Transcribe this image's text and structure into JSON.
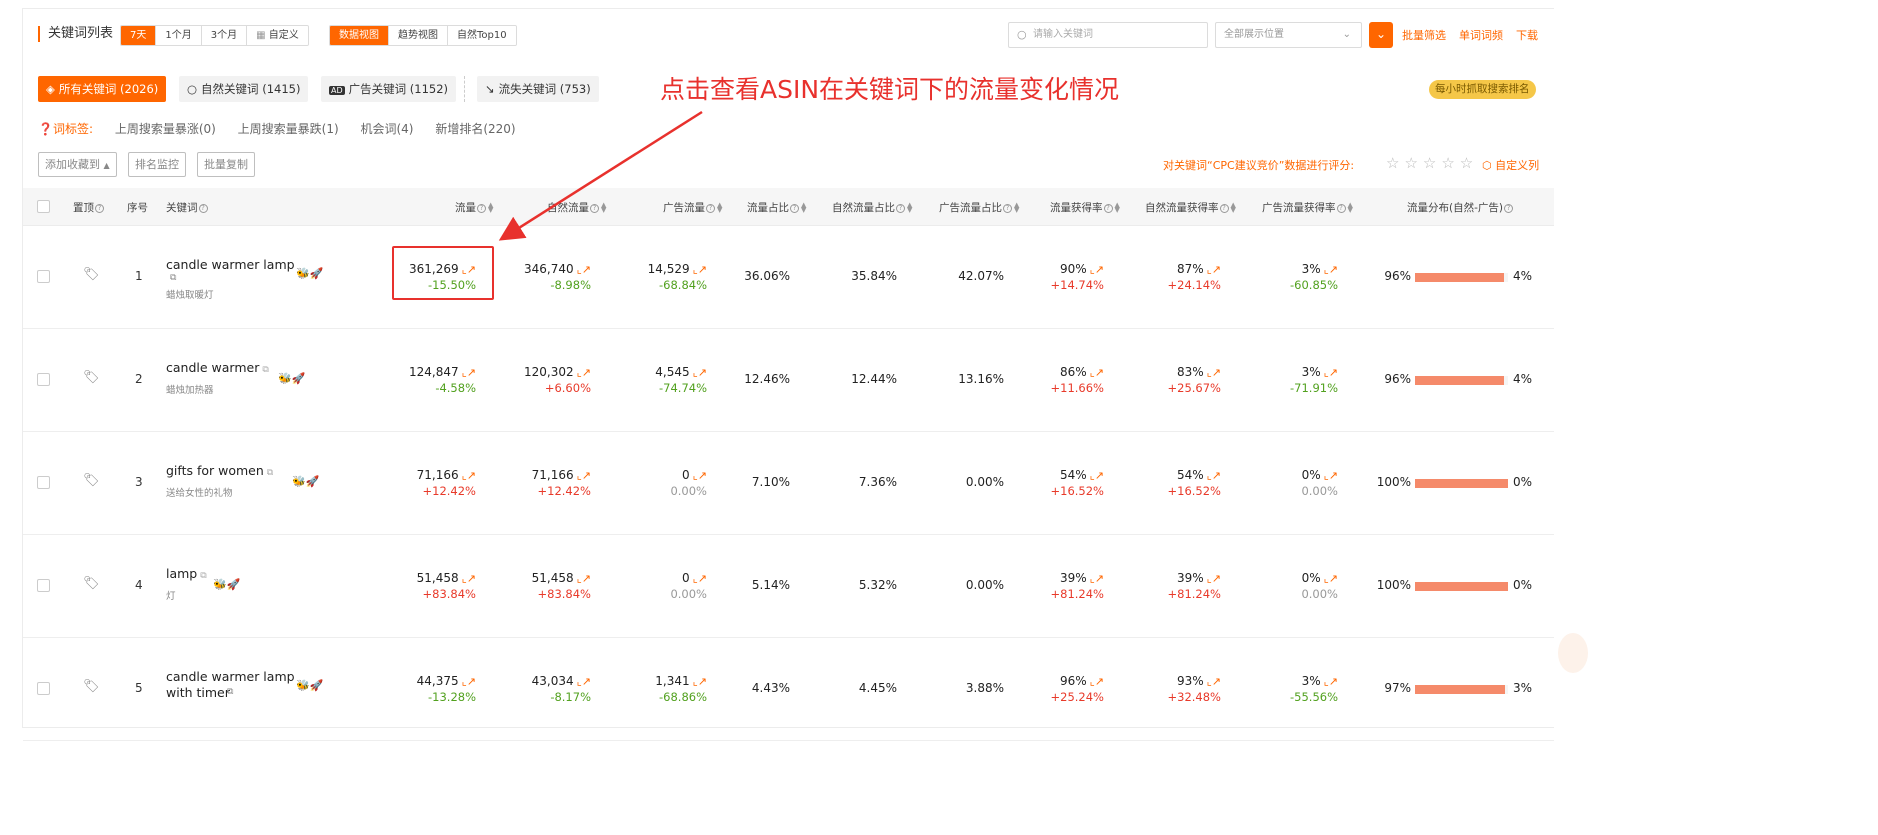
{
  "header": {
    "title": "关键词列表",
    "periods": [
      "7天",
      "1个月",
      "3个月",
      "自定义"
    ],
    "views": [
      "数据视图",
      "趋势视图",
      "自然Top10"
    ],
    "search_placeholder": "请输入关键词",
    "position_select": "全部展示位置",
    "links": [
      "批量筛选",
      "单词词频",
      "下载"
    ]
  },
  "filters": {
    "chips": [
      {
        "label": "所有关键词 (2026)",
        "icon": "layers-icon"
      },
      {
        "label": "自然关键词 (1415)",
        "icon": "search-icon"
      },
      {
        "label": "广告关键词 (1152)",
        "icon": "ad-icon"
      },
      {
        "label": "流失关键词 (753)",
        "icon": "trend-down-icon"
      }
    ],
    "badge": "每小时抓取搜索排名",
    "tag_label": "词标签:",
    "tags": [
      "上周搜索量暴涨(0)",
      "上周搜索量暴跌(1)",
      "机会词(4)",
      "新增排名(220)"
    ]
  },
  "annotation": "点击查看ASIN在关键词下的流量变化情况",
  "toolbar": {
    "buttons": [
      "添加收藏到",
      "排名监控",
      "批量复制"
    ],
    "rate_text": "对关键词“CPC建议竞价”数据进行评分:",
    "stars": "☆☆☆☆☆",
    "custom_cols": "自定义列"
  },
  "columns": [
    "置顶",
    "序号",
    "关键词",
    "流量",
    "自然流量",
    "广告流量",
    "流量占比",
    "自然流量占比",
    "广告流量占比",
    "流量获得率",
    "自然流量获得率",
    "广告流量获得率",
    "流量分布(自然-广告)"
  ],
  "rows": [
    {
      "idx": "1",
      "kw": "candle warmer lamp",
      "zh": "蜡烛取暖灯",
      "traffic": "361,269",
      "traffic_chg": "-15.50%",
      "org": "346,740",
      "org_chg": "-8.98%",
      "ad": "14,529",
      "ad_chg": "-68.84%",
      "share": "36.06%",
      "org_share": "35.84%",
      "ad_share": "42.07%",
      "rate": "90%",
      "rate_chg": "+14.74%",
      "org_rate": "87%",
      "org_rate_chg": "+24.14%",
      "ad_rate": "3%",
      "ad_rate_chg": "-60.85%",
      "dist_l": "96%",
      "dist_r": "4%",
      "dist": 0.96
    },
    {
      "idx": "2",
      "kw": "candle warmer",
      "zh": "蜡烛加热器",
      "traffic": "124,847",
      "traffic_chg": "-4.58%",
      "org": "120,302",
      "org_chg": "+6.60%",
      "ad": "4,545",
      "ad_chg": "-74.74%",
      "share": "12.46%",
      "org_share": "12.44%",
      "ad_share": "13.16%",
      "rate": "86%",
      "rate_chg": "+11.66%",
      "org_rate": "83%",
      "org_rate_chg": "+25.67%",
      "ad_rate": "3%",
      "ad_rate_chg": "-71.91%",
      "dist_l": "96%",
      "dist_r": "4%",
      "dist": 0.96
    },
    {
      "idx": "3",
      "kw": "gifts for women",
      "zh": "送给女性的礼物",
      "traffic": "71,166",
      "traffic_chg": "+12.42%",
      "org": "71,166",
      "org_chg": "+12.42%",
      "ad": "0",
      "ad_chg": "0.00%",
      "share": "7.10%",
      "org_share": "7.36%",
      "ad_share": "0.00%",
      "rate": "54%",
      "rate_chg": "+16.52%",
      "org_rate": "54%",
      "org_rate_chg": "+16.52%",
      "ad_rate": "0%",
      "ad_rate_chg": "0.00%",
      "dist_l": "100%",
      "dist_r": "0%",
      "dist": 1.0
    },
    {
      "idx": "4",
      "kw": "lamp",
      "zh": "灯",
      "traffic": "51,458",
      "traffic_chg": "+83.84%",
      "org": "51,458",
      "org_chg": "+83.84%",
      "ad": "0",
      "ad_chg": "0.00%",
      "share": "5.14%",
      "org_share": "5.32%",
      "ad_share": "0.00%",
      "rate": "39%",
      "rate_chg": "+81.24%",
      "org_rate": "39%",
      "org_rate_chg": "+81.24%",
      "ad_rate": "0%",
      "ad_rate_chg": "0.00%",
      "dist_l": "100%",
      "dist_r": "0%",
      "dist": 1.0
    },
    {
      "idx": "5",
      "kw": "candle warmer lamp",
      "kw2": "with timer",
      "zh": "",
      "traffic": "44,375",
      "traffic_chg": "-13.28%",
      "org": "43,034",
      "org_chg": "-8.17%",
      "ad": "1,341",
      "ad_chg": "-68.86%",
      "share": "4.43%",
      "org_share": "4.45%",
      "ad_share": "3.88%",
      "rate": "96%",
      "rate_chg": "+25.24%",
      "org_rate": "93%",
      "org_rate_chg": "+32.48%",
      "ad_rate": "3%",
      "ad_rate_chg": "-55.56%",
      "dist_l": "97%",
      "dist_r": "3%",
      "dist": 0.97
    }
  ],
  "colors": {
    "accent": "#ff6600",
    "negative": "#52a11f",
    "positive": "#e83a2a",
    "annotation": "#e8312d",
    "bar": "#f58a6a"
  }
}
